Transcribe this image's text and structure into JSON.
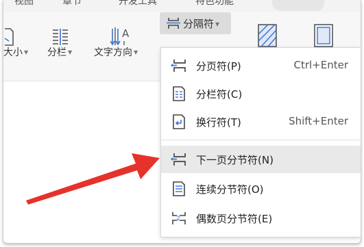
{
  "top_tabs": [
    "视图",
    "章节",
    "开发工具",
    "特色功能"
  ],
  "ribbon": {
    "font_size_label": "大小",
    "columns_label": "分栏",
    "text_direction_label": "文字方向",
    "separator_label": "分隔符"
  },
  "menu": {
    "items": [
      {
        "label": "分页符(P)",
        "shortcut": "Ctrl+Enter"
      },
      {
        "label": "分栏符(C)",
        "shortcut": ""
      },
      {
        "label": "换行符(T)",
        "shortcut": "Shift+Enter"
      },
      {
        "label": "下一页分节符(N)",
        "shortcut": ""
      },
      {
        "label": "连续分节符(O)",
        "shortcut": ""
      },
      {
        "label": "偶数页分节符(E)",
        "shortcut": ""
      }
    ]
  },
  "colors": {
    "accent_blue": "#3a6fd0",
    "highlight_gray": "#e9e9e9",
    "annotation_arrow": "#e5322b"
  },
  "icons": {
    "columns": "columns-icon",
    "text_direction": "text-direction-icon",
    "separator": "separator-icon",
    "page_break": "page-break-icon",
    "column_break": "column-break-icon",
    "line_break": "line-break-icon",
    "next_page_section": "next-page-section-icon",
    "continuous_section": "continuous-section-icon",
    "even_page_section": "even-page-section-icon"
  }
}
